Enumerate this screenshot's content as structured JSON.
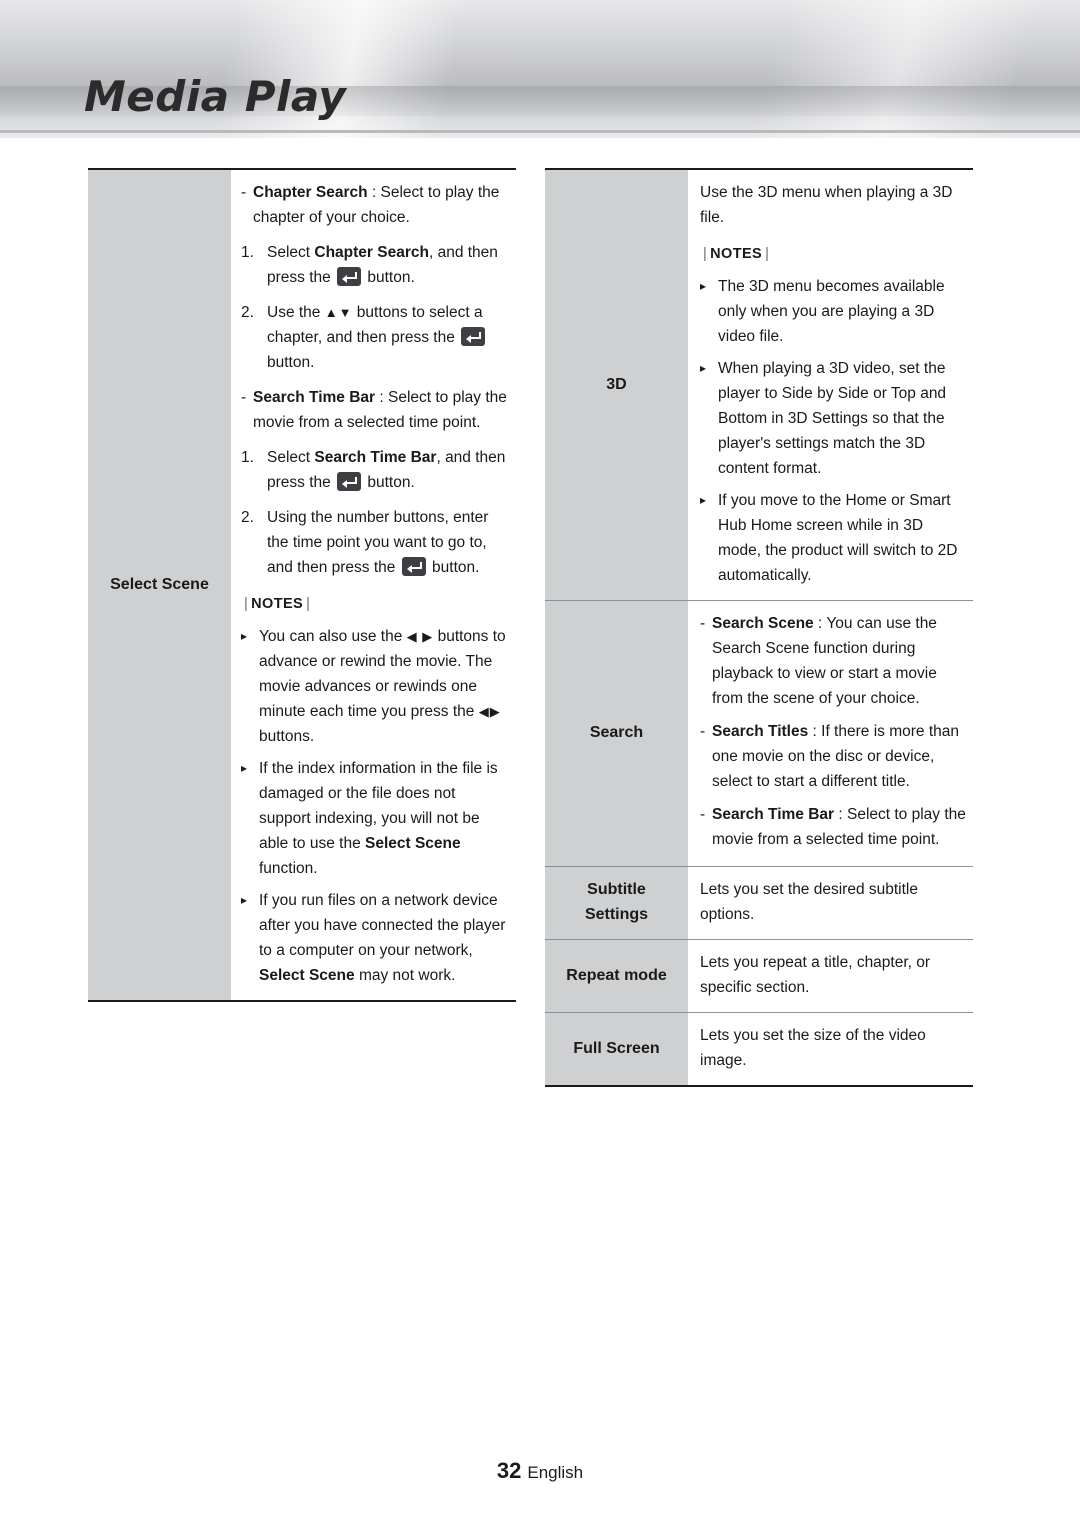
{
  "header": {
    "title": "Media Play"
  },
  "footer": {
    "page": "32",
    "language": "English"
  },
  "left_table": {
    "label": "Select Scene",
    "items": [
      {
        "type": "dash",
        "bold": "Chapter Search",
        "rest": " : Select to play the chapter of your choice."
      },
      {
        "type": "num",
        "num": "1.",
        "text": "Select Chapter Search, and then press the [KEY] button.",
        "bold_part": "Chapter Search"
      },
      {
        "type": "num",
        "num": "2.",
        "text": "Use the ▲▼ buttons to select a chapter, and then press the [KEY] button."
      },
      {
        "type": "dash",
        "bold": "Search Time Bar",
        "rest": " : Select to play the movie from a selected time point."
      },
      {
        "type": "num",
        "num": "1.",
        "text": "Select Search Time Bar, and then press the [KEY] button.",
        "bold_part": "Search Time Bar"
      },
      {
        "type": "num",
        "num": "2.",
        "text": "Using the number buttons, enter the time point you want to go to, and then press the [KEY] button."
      }
    ],
    "notes_label": "NOTES",
    "notes": [
      "You can also use the ◀ ▶ buttons to advance or rewind the movie. The movie advances or rewinds one minute each time you press the ◀▶ buttons.",
      "If the index information in the file is damaged or the file does not support indexing, you will not be able to use the Select Scene function.",
      "If you run files on a network device after you have connected the player to a computer on your network, Select Scene may not work."
    ]
  },
  "right_table": {
    "rows": [
      {
        "label": "3D",
        "intro": "Use the 3D menu when playing a 3D file.",
        "notes_label": "NOTES",
        "notes": [
          "The 3D menu becomes available only when you are playing a 3D video file.",
          "When playing a 3D video, set the player to Side by Side or Top and Bottom in 3D Settings so that the player's settings match the 3D content format.",
          "If you move to the Home or Smart Hub Home screen while in 3D mode, the product will switch to 2D automatically."
        ]
      },
      {
        "label": "Search",
        "items": [
          {
            "bold": "Search Scene",
            "rest": " : You can use the Search Scene function during playback to view or start a movie from the scene of your choice."
          },
          {
            "bold": "Search Titles",
            "rest": " : If there is more than one movie on the disc or device, select to start a different title."
          },
          {
            "bold": "Search Time Bar",
            "rest": " : Select to play the movie from a selected time point."
          }
        ]
      },
      {
        "label": "Subtitle Settings",
        "label_line1": "Subtitle",
        "label_line2": "Settings",
        "text": "Lets you set the desired subtitle options."
      },
      {
        "label": "Repeat mode",
        "text": "Lets you repeat a title, chapter, or specific section."
      },
      {
        "label": "Full Screen",
        "text": "Lets you set the size of the video image."
      }
    ]
  }
}
